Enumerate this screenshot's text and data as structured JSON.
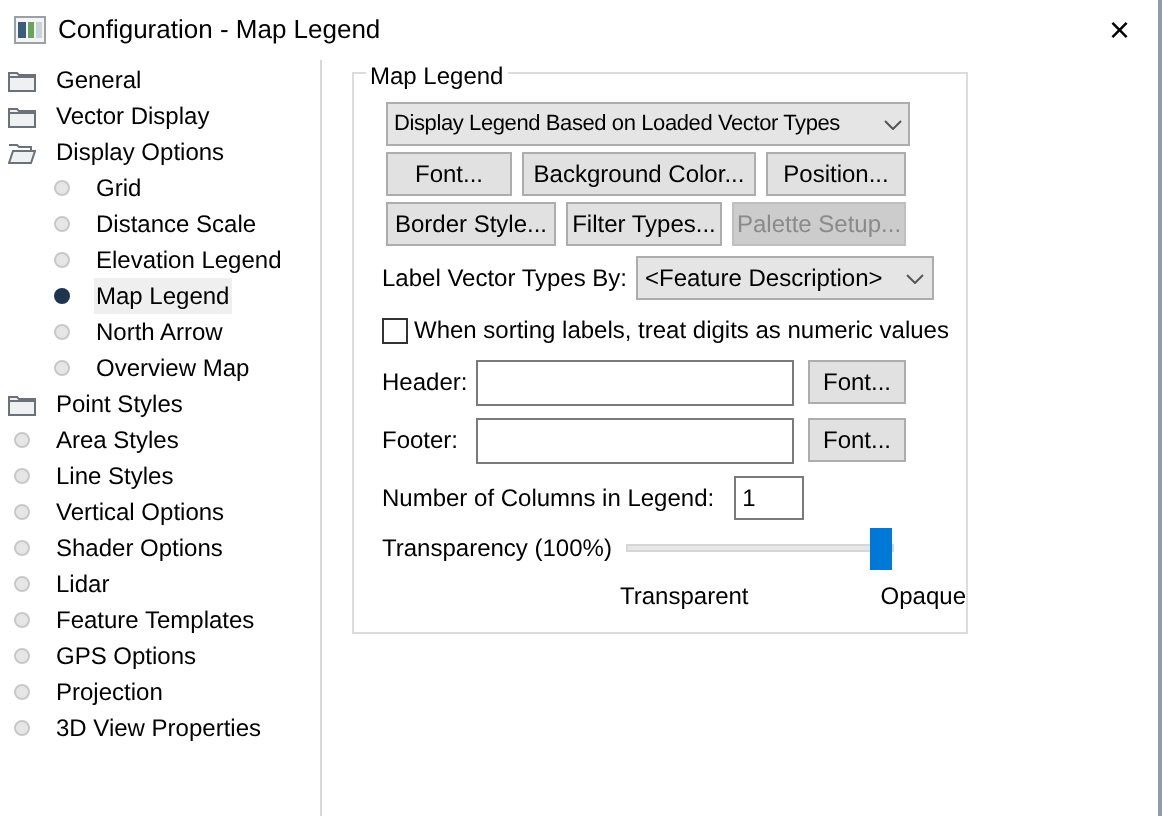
{
  "window": {
    "title": "Configuration - Map Legend",
    "close": "×"
  },
  "sidebar": {
    "items": [
      {
        "label": "General",
        "kind": "folder",
        "expanded": false,
        "selected": false
      },
      {
        "label": "Vector Display",
        "kind": "folder",
        "expanded": false,
        "selected": false
      },
      {
        "label": "Display Options",
        "kind": "folder",
        "expanded": true,
        "selected": false,
        "children": [
          {
            "label": "Grid",
            "kind": "leaf",
            "selected": false
          },
          {
            "label": "Distance Scale",
            "kind": "leaf",
            "selected": false
          },
          {
            "label": "Elevation Legend",
            "kind": "leaf",
            "selected": false
          },
          {
            "label": "Map Legend",
            "kind": "leaf",
            "selected": true
          },
          {
            "label": "North Arrow",
            "kind": "leaf",
            "selected": false
          },
          {
            "label": "Overview Map",
            "kind": "leaf",
            "selected": false
          }
        ]
      },
      {
        "label": "Point Styles",
        "kind": "folder",
        "expanded": false,
        "selected": false
      },
      {
        "label": "Area Styles",
        "kind": "leaf",
        "selected": false
      },
      {
        "label": "Line Styles",
        "kind": "leaf",
        "selected": false
      },
      {
        "label": "Vertical Options",
        "kind": "leaf",
        "selected": false
      },
      {
        "label": "Shader Options",
        "kind": "leaf",
        "selected": false
      },
      {
        "label": "Lidar",
        "kind": "leaf",
        "selected": false
      },
      {
        "label": "Feature Templates",
        "kind": "leaf",
        "selected": false
      },
      {
        "label": "GPS Options",
        "kind": "leaf",
        "selected": false
      },
      {
        "label": "Projection",
        "kind": "leaf",
        "selected": false
      },
      {
        "label": "3D View Properties",
        "kind": "leaf",
        "selected": false
      }
    ]
  },
  "group": {
    "title": "Map Legend",
    "mode_dropdown": "Display Legend Based on Loaded Vector Types",
    "button_rows": [
      [
        {
          "label": "Font...",
          "disabled": false
        },
        {
          "label": "Background Color...",
          "disabled": false
        },
        {
          "label": "Position...",
          "disabled": false
        }
      ],
      [
        {
          "label": "Border Style...",
          "disabled": false
        },
        {
          "label": "Filter Types...",
          "disabled": false
        },
        {
          "label": "Palette Setup...",
          "disabled": true
        }
      ]
    ],
    "label_by": {
      "label": "Label Vector Types By:",
      "value": "<Feature Description>"
    },
    "numeric_sort": {
      "label": "When sorting labels, treat digits as numeric values",
      "checked": false
    },
    "text_fields": [
      {
        "label": "Header:",
        "button": "Font..."
      },
      {
        "label": "Footer:",
        "button": "Font..."
      }
    ],
    "columns": {
      "label": "Number of Columns in Legend:",
      "value": "1"
    },
    "transparency": {
      "label": "Transparency (100%)",
      "level": 1,
      "min_label": "Transparent",
      "max_label": "Opaque"
    }
  }
}
